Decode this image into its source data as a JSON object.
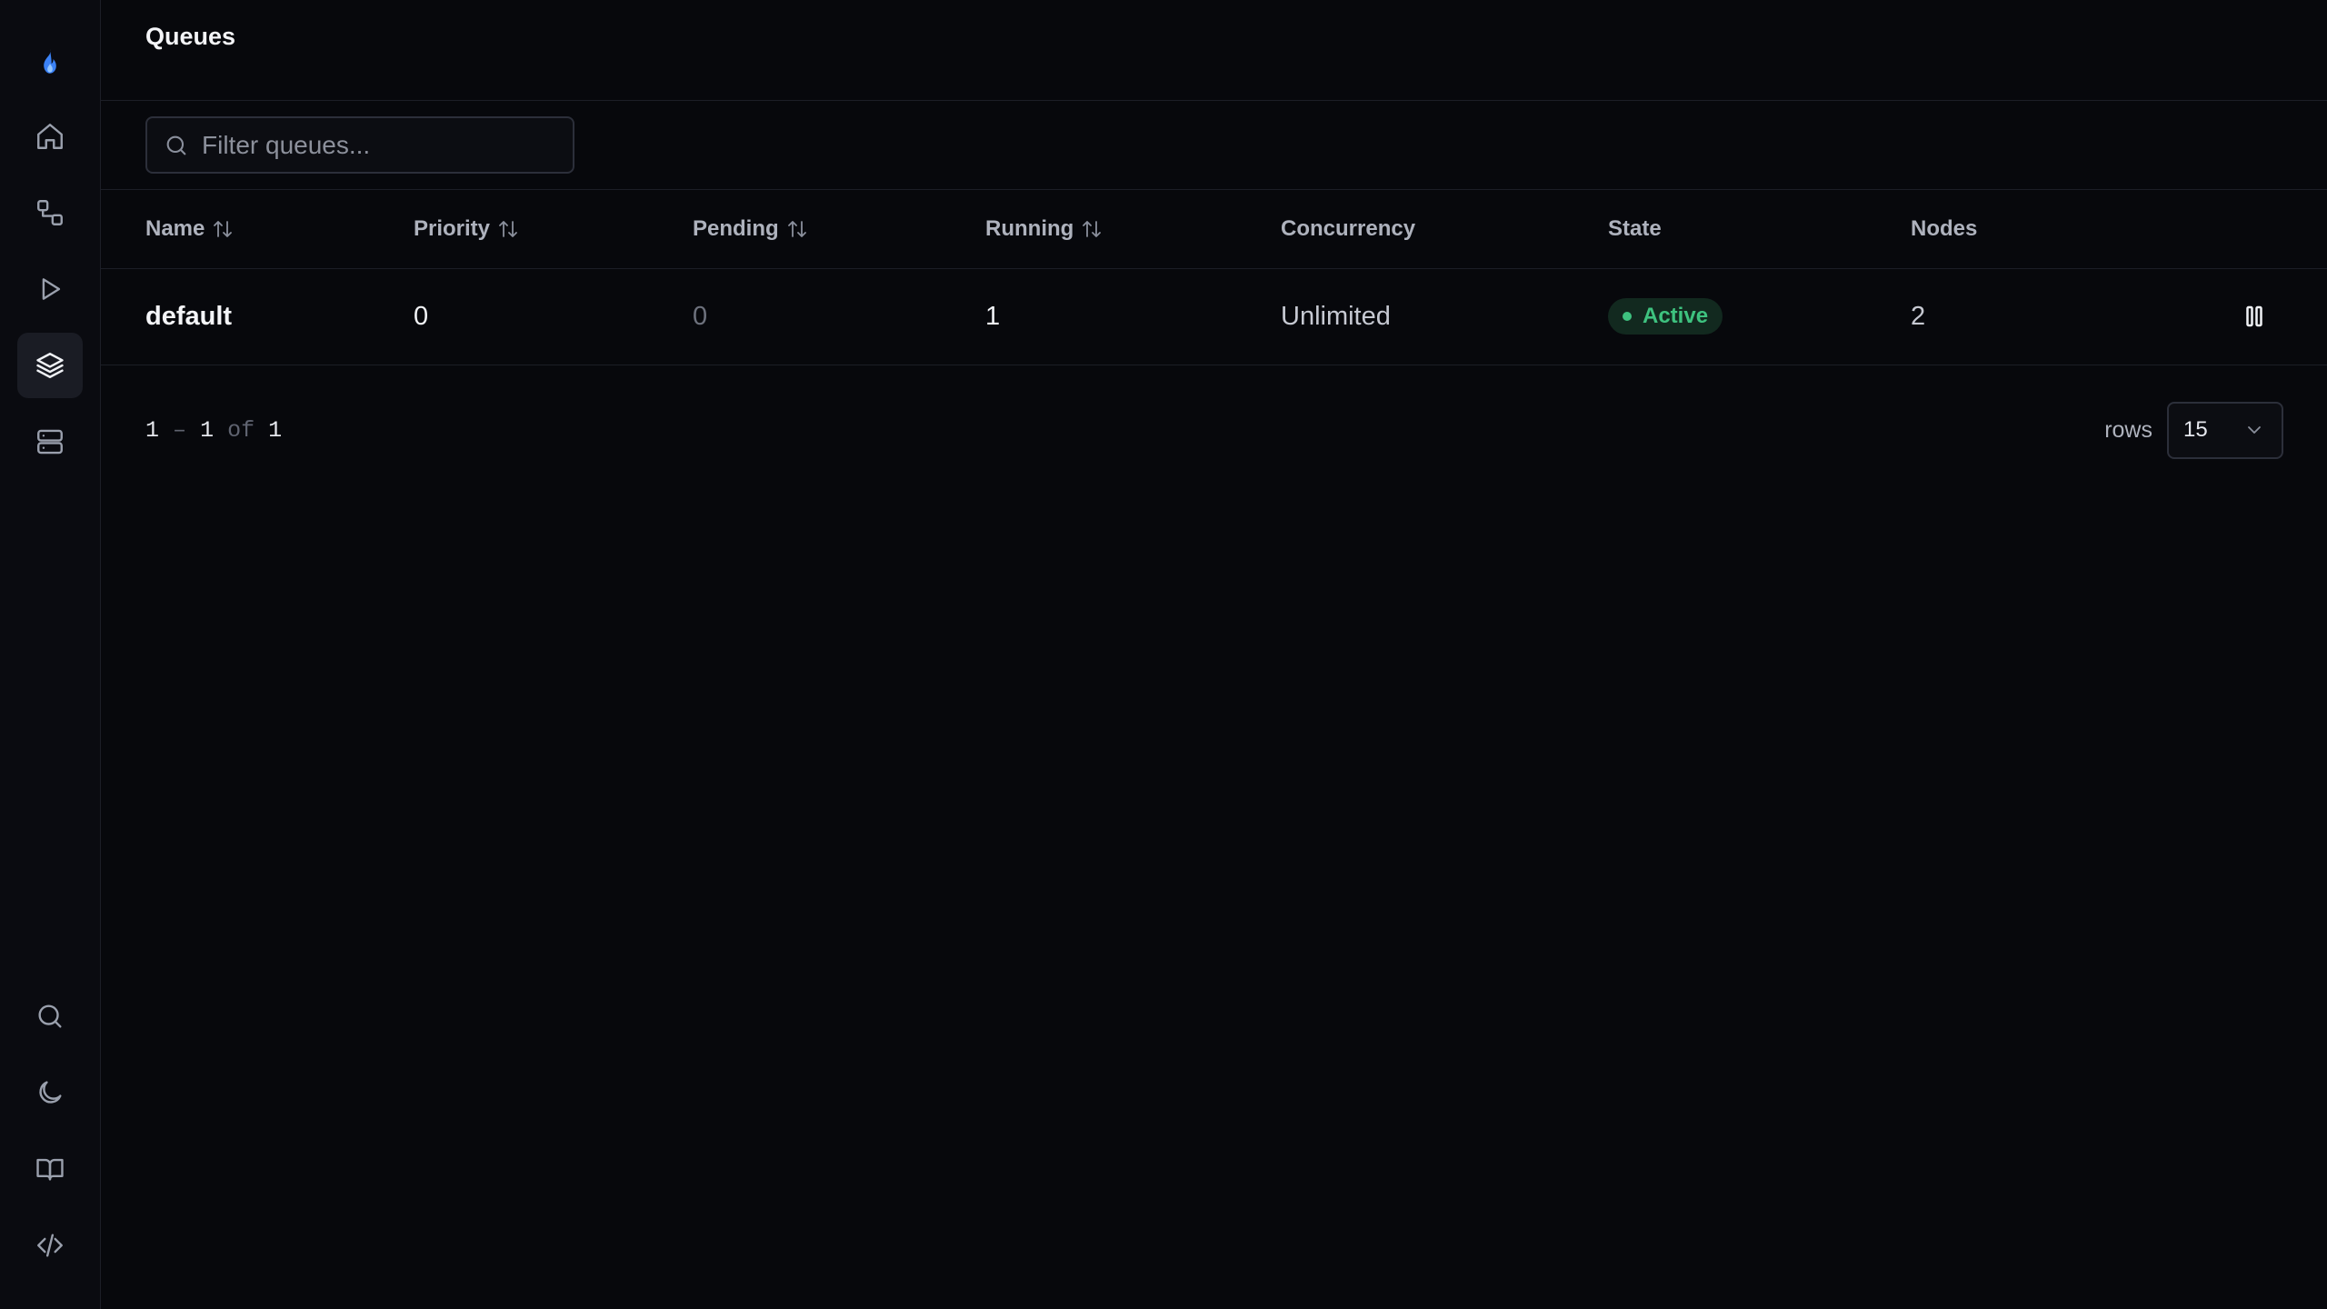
{
  "header": {
    "title": "Queues"
  },
  "search": {
    "placeholder": "Filter queues..."
  },
  "sidebar": {
    "top_items": [
      {
        "icon": "flame-logo"
      },
      {
        "icon": "home-icon"
      },
      {
        "icon": "workflow-icon"
      },
      {
        "icon": "play-icon"
      },
      {
        "icon": "layers-icon",
        "active": true
      },
      {
        "icon": "server-icon"
      }
    ],
    "bottom_items": [
      {
        "icon": "search-icon"
      },
      {
        "icon": "moon-icon"
      },
      {
        "icon": "book-icon"
      },
      {
        "icon": "code-icon"
      }
    ]
  },
  "table": {
    "columns": [
      "Name",
      "Priority",
      "Pending",
      "Running",
      "Concurrency",
      "State",
      "Nodes"
    ],
    "rows": [
      {
        "name": "default",
        "priority": "0",
        "pending": "0",
        "running": "1",
        "concurrency": "Unlimited",
        "state": "Active",
        "nodes": "2"
      }
    ]
  },
  "pagination": {
    "start": "1",
    "sep": "–",
    "end": "1",
    "of": "of",
    "total": "1",
    "rows_label": "rows",
    "rows_value": "15"
  },
  "colors": {
    "background": "#07080c",
    "active_badge_text": "#3ec27f",
    "active_badge_bg": "#12291f",
    "logo_blue": "#3b82f6"
  }
}
